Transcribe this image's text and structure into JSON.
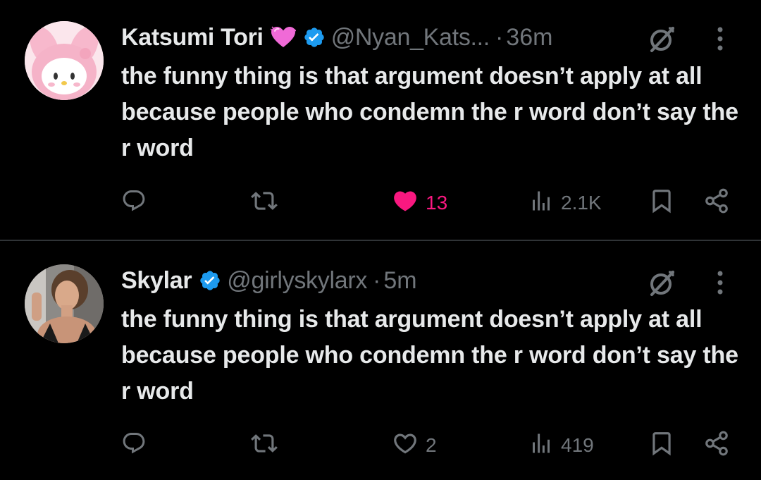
{
  "tweets": [
    {
      "name": "Katsumi Tori",
      "handle": "@Nyan_Kats...",
      "separator": "·",
      "time": "36m",
      "text": "the funny thing is that argument doesn’t apply at all because people who condemn the r word don’t say the r word",
      "reply_count": "",
      "retweet_count": "",
      "like_count": "13",
      "liked": true,
      "view_count": "2.1K"
    },
    {
      "name": "Skylar",
      "handle": "@girlyskylarx",
      "separator": "·",
      "time": "5m",
      "text": "the funny thing is that argument doesn’t apply at all because people who condemn the r word don’t say the r word",
      "reply_count": "",
      "retweet_count": "",
      "like_count": "2",
      "liked": false,
      "view_count": "419"
    }
  ],
  "icons": {
    "reply": "reply-icon",
    "retweet": "retweet-icon",
    "like": "heart-icon",
    "views": "views-icon",
    "bookmark": "bookmark-icon",
    "share": "share-icon",
    "grok": "grok-icon",
    "more": "more-icon",
    "verified": "verified-badge-icon",
    "emoji": "pink-heart-emoji"
  },
  "colors": {
    "background": "#000000",
    "text": "#e7e9ea",
    "muted": "#71767b",
    "like_active": "#f91880",
    "verified": "#1d9bf0",
    "divider": "#2f3336"
  }
}
